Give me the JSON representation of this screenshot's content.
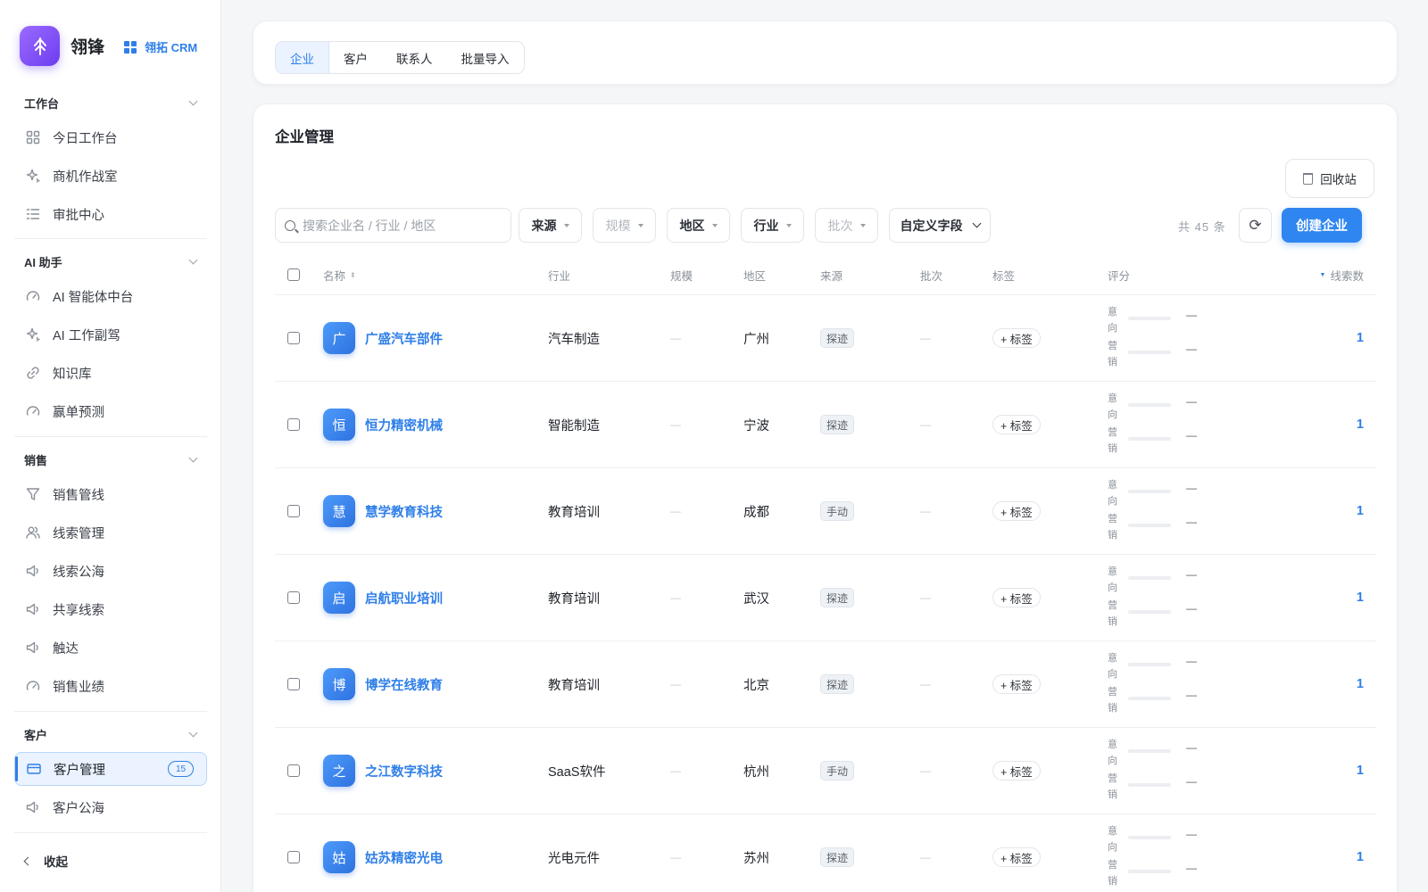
{
  "brand": {
    "name": "翎锋",
    "tag": "翎拓 CRM"
  },
  "sidebar": {
    "groups": [
      {
        "title": "工作台",
        "items": [
          {
            "label": "今日工作台",
            "icon": "dashboard-icon"
          },
          {
            "label": "商机作战室",
            "icon": "sparkle-icon"
          },
          {
            "label": "审批中心",
            "icon": "list-icon"
          }
        ]
      },
      {
        "title": "AI 助手",
        "items": [
          {
            "label": "AI 智能体中台",
            "icon": "gauge-icon"
          },
          {
            "label": "AI 工作副驾",
            "icon": "sparkle-icon"
          },
          {
            "label": "知识库",
            "icon": "link-icon"
          },
          {
            "label": "赢单预测",
            "icon": "gauge-icon"
          }
        ]
      },
      {
        "title": "销售",
        "items": [
          {
            "label": "销售管线",
            "icon": "funnel-icon"
          },
          {
            "label": "线索管理",
            "icon": "users-icon"
          },
          {
            "label": "线索公海",
            "icon": "megaphone-icon"
          },
          {
            "label": "共享线索",
            "icon": "megaphone-icon"
          },
          {
            "label": "触达",
            "icon": "megaphone-icon"
          },
          {
            "label": "销售业绩",
            "icon": "gauge-icon"
          }
        ]
      },
      {
        "title": "客户",
        "items": [
          {
            "label": "客户管理",
            "icon": "card-icon",
            "badge": "15",
            "active": true
          },
          {
            "label": "客户公海",
            "icon": "megaphone-icon"
          }
        ]
      }
    ],
    "collapse_label": "收起"
  },
  "tabs": [
    "企业",
    "客户",
    "联系人",
    "批量导入"
  ],
  "page": {
    "title": "企业管理",
    "recycle_label": "回收站",
    "search_placeholder": "搜索企业名 / 行业 / 地区",
    "filters": [
      {
        "label": "来源",
        "disabled": false
      },
      {
        "label": "规模",
        "disabled": true
      },
      {
        "label": "地区",
        "disabled": false
      },
      {
        "label": "行业",
        "disabled": false
      },
      {
        "label": "批次",
        "disabled": true
      }
    ],
    "custom_fields_label": "自定义字段",
    "total_label": "共 45 条",
    "create_label": "创建企业"
  },
  "table": {
    "columns": {
      "name": "名称",
      "industry": "行业",
      "scale": "规模",
      "region": "地区",
      "source": "来源",
      "batch": "批次",
      "tags": "标签",
      "score": "评分",
      "leads": "线索数"
    },
    "score_labels": {
      "intent": "意向",
      "marketing": "营销"
    },
    "empty": "—",
    "add_tag_label": "+ 标签",
    "rows": [
      {
        "initial": "广",
        "name": "广盛汽车部件",
        "industry": "汽车制造",
        "region": "广州",
        "source": "探迹",
        "intent": "—",
        "marketing": "—",
        "leads": "1"
      },
      {
        "initial": "恒",
        "name": "恒力精密机械",
        "industry": "智能制造",
        "region": "宁波",
        "source": "探迹",
        "intent": "—",
        "marketing": "—",
        "leads": "1"
      },
      {
        "initial": "慧",
        "name": "慧学教育科技",
        "industry": "教育培训",
        "region": "成都",
        "source": "手动",
        "intent": "—",
        "marketing": "—",
        "leads": "1"
      },
      {
        "initial": "启",
        "name": "启航职业培训",
        "industry": "教育培训",
        "region": "武汉",
        "source": "探迹",
        "intent": "—",
        "marketing": "—",
        "leads": "1"
      },
      {
        "initial": "博",
        "name": "博学在线教育",
        "industry": "教育培训",
        "region": "北京",
        "source": "探迹",
        "intent": "—",
        "marketing": "—",
        "leads": "1"
      },
      {
        "initial": "之",
        "name": "之江数字科技",
        "industry": "SaaS软件",
        "region": "杭州",
        "source": "手动",
        "intent": "—",
        "marketing": "—",
        "leads": "1"
      },
      {
        "initial": "姑",
        "name": "姑苏精密光电",
        "industry": "光电元件",
        "region": "苏州",
        "source": "探迹",
        "intent": "—",
        "marketing": "—",
        "leads": "1"
      }
    ]
  }
}
